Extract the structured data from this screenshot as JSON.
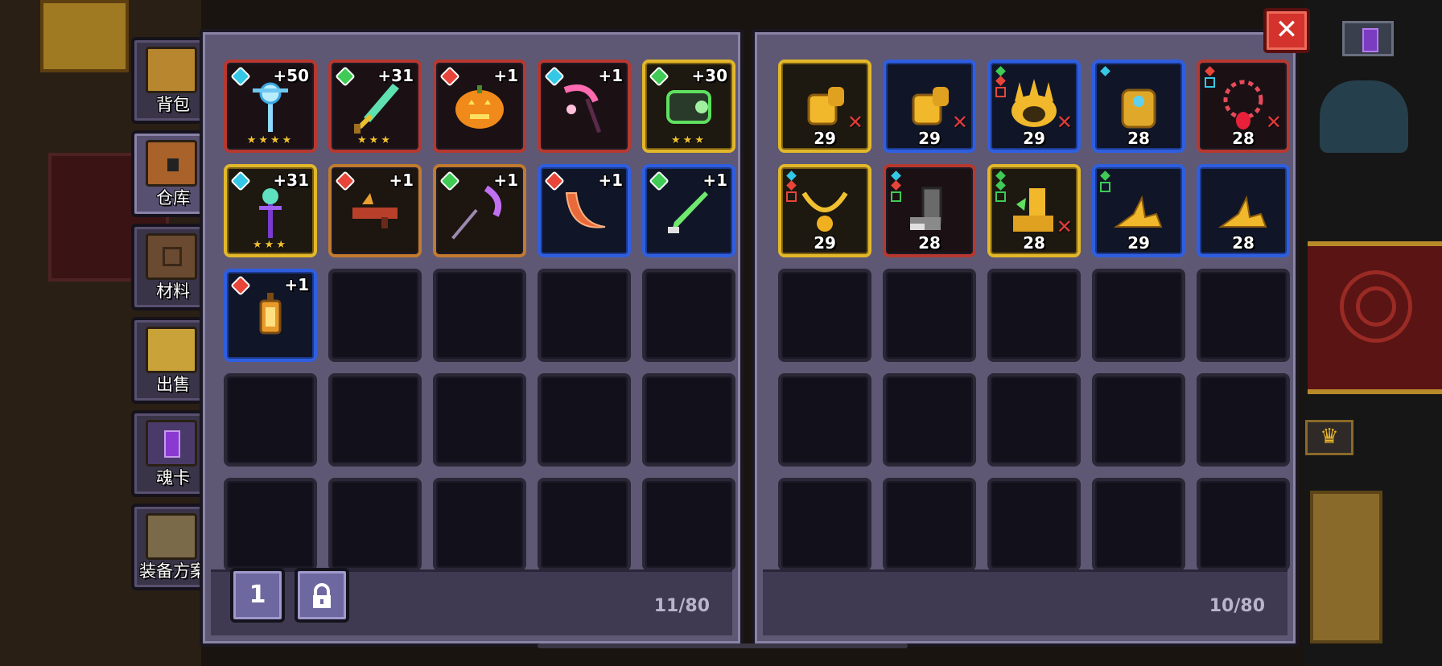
{
  "tabs": [
    {
      "label": "背包",
      "icon": "backpack-icon",
      "active": false
    },
    {
      "label": "仓库",
      "icon": "storage-chest-icon",
      "active": true
    },
    {
      "label": "材料",
      "icon": "materials-icon",
      "active": false
    },
    {
      "label": "出售",
      "icon": "sell-icon",
      "active": false
    },
    {
      "label": "魂卡",
      "icon": "soul-card-icon",
      "active": false
    },
    {
      "label": "装备方案",
      "icon": "equipment-plan-icon",
      "active": false
    }
  ],
  "left_panel": {
    "count": "11/80",
    "page_button": "1",
    "lock_icon": "lock-icon",
    "items": [
      {
        "icon": "ice-staff-icon",
        "rarity": "red",
        "gem": "#35c8e6",
        "plus": "+50",
        "stars": "★★★★"
      },
      {
        "icon": "green-sword-icon",
        "rarity": "red",
        "gem": "#3fcb55",
        "plus": "+31",
        "stars": "★★★"
      },
      {
        "icon": "pumpkin-icon",
        "rarity": "red",
        "gem": "#e8453a",
        "plus": "+1",
        "stars": ""
      },
      {
        "icon": "sakura-scythe-icon",
        "rarity": "red",
        "gem": "#35c8e6",
        "plus": "+1",
        "stars": ""
      },
      {
        "icon": "green-gauntlet-icon",
        "rarity": "gold",
        "gem": "#3fcb55",
        "plus": "+30",
        "stars": "★★★"
      },
      {
        "icon": "purple-staff-icon",
        "rarity": "gold",
        "gem": "#35c8e6",
        "plus": "+31",
        "stars": "★★★"
      },
      {
        "icon": "dragon-gun-icon",
        "rarity": "orange",
        "gem": "#e8453a",
        "plus": "+1",
        "stars": ""
      },
      {
        "icon": "purple-scythe-icon",
        "rarity": "orange",
        "gem": "#3fcb55",
        "plus": "+1",
        "stars": ""
      },
      {
        "icon": "crescent-blade-icon",
        "rarity": "blue",
        "gem": "#e8453a",
        "plus": "+1",
        "stars": ""
      },
      {
        "icon": "green-dagger-icon",
        "rarity": "blue",
        "gem": "#3fcb55",
        "plus": "+1",
        "stars": ""
      },
      {
        "icon": "lantern-icon",
        "rarity": "blue",
        "gem": "#e8453a",
        "plus": "+1",
        "stars": ""
      }
    ]
  },
  "right_panel": {
    "count": "10/80",
    "items": [
      {
        "icon": "gold-gloves-icon",
        "rarity": "gold",
        "level": "29",
        "marked": true
      },
      {
        "icon": "gold-gloves-icon",
        "rarity": "blue",
        "level": "29",
        "marked": true
      },
      {
        "icon": "spiked-helmet-icon",
        "rarity": "blue",
        "level": "29",
        "marked": true
      },
      {
        "icon": "gold-armor-icon",
        "rarity": "blue",
        "level": "28",
        "marked": false
      },
      {
        "icon": "ruby-necklace-icon",
        "rarity": "red",
        "level": "28",
        "marked": true
      },
      {
        "icon": "gold-necklace-icon",
        "rarity": "gold",
        "level": "29",
        "marked": false
      },
      {
        "icon": "iron-boots-icon",
        "rarity": "red",
        "level": "28",
        "marked": false
      },
      {
        "icon": "gold-boots-icon",
        "rarity": "gold",
        "level": "28",
        "marked": true
      },
      {
        "icon": "gold-shoes-icon",
        "rarity": "blue",
        "level": "29",
        "marked": false
      },
      {
        "icon": "gold-shoes-icon",
        "rarity": "blue",
        "level": "28",
        "marked": false
      }
    ]
  },
  "close_label": "✕",
  "scene": {
    "crown_icon": "crown-icon",
    "marker_icon": "soul-gem-marker-icon"
  }
}
